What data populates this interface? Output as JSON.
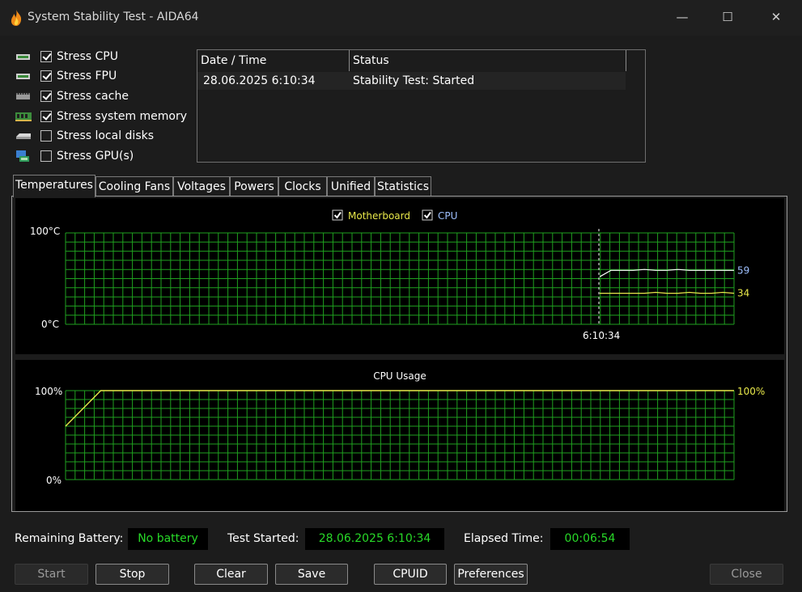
{
  "window": {
    "title": "System Stability Test - AIDA64",
    "min_glyph": "—",
    "max_glyph": "☐",
    "close_glyph": "✕"
  },
  "stress": [
    {
      "label": "Stress CPU",
      "checked": true,
      "icon": "cpu-chip-icon"
    },
    {
      "label": "Stress FPU",
      "checked": true,
      "icon": "fpu-chip-icon"
    },
    {
      "label": "Stress cache",
      "checked": true,
      "icon": "cache-chip-icon"
    },
    {
      "label": "Stress system memory",
      "checked": true,
      "icon": "memory-module-icon"
    },
    {
      "label": "Stress local disks",
      "checked": false,
      "icon": "disk-drive-icon"
    },
    {
      "label": "Stress GPU(s)",
      "checked": false,
      "icon": "gpu-card-icon"
    }
  ],
  "log": {
    "columns": [
      "Date / Time",
      "Status"
    ],
    "rows": [
      {
        "datetime": "28.06.2025 6:10:34",
        "status": "Stability Test: Started"
      }
    ]
  },
  "tabs": [
    "Temperatures",
    "Cooling Fans",
    "Voltages",
    "Powers",
    "Clocks",
    "Unified",
    "Statistics"
  ],
  "active_tab": "Temperatures",
  "colors": {
    "grid": "#1fa11f",
    "motherboard": "#e8e84a",
    "cpu": "#ffffff",
    "cpu_legend_text": "#9fc1ff",
    "status_value": "#28d928"
  },
  "chart_data": [
    {
      "type": "line",
      "legend": [
        {
          "name": "Motherboard",
          "checked": true
        },
        {
          "name": "CPU",
          "checked": true
        }
      ],
      "ytop_label": "100°C",
      "ybottom_label": "0°C",
      "ylim": [
        0,
        100
      ],
      "time_marker": "6:10:34",
      "series": [
        {
          "name": "CPU",
          "values": [
            52,
            59,
            59,
            59,
            60,
            59,
            59,
            60,
            59,
            59,
            59,
            59,
            59
          ],
          "current_label": "59"
        },
        {
          "name": "Motherboard",
          "values": [
            34,
            34,
            34,
            34,
            34,
            35,
            34,
            34,
            35,
            34,
            34,
            35,
            34
          ],
          "current_label": "34"
        }
      ]
    },
    {
      "type": "line",
      "title": "CPU Usage",
      "ytop_label": "100%",
      "ybottom_label": "0%",
      "ylim": [
        0,
        100
      ],
      "series": [
        {
          "name": "CPU Usage",
          "values": [
            60,
            100,
            100,
            100,
            100,
            100,
            100,
            100,
            100,
            100,
            100,
            100,
            100,
            100,
            100,
            100,
            100,
            100,
            100,
            100
          ],
          "current_label": "100%"
        }
      ]
    }
  ],
  "status": {
    "battery_label": "Remaining Battery:",
    "battery_value": "No battery",
    "started_label": "Test Started:",
    "started_value": "28.06.2025 6:10:34",
    "elapsed_label": "Elapsed Time:",
    "elapsed_value": "00:06:54"
  },
  "buttons": {
    "start": "Start",
    "stop": "Stop",
    "clear": "Clear",
    "save": "Save",
    "cpuid": "CPUID",
    "preferences": "Preferences",
    "close": "Close"
  }
}
